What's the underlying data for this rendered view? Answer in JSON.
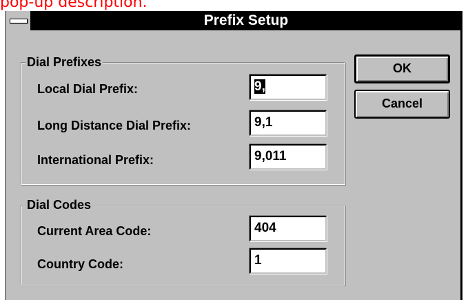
{
  "caption": "pop-up description.",
  "window": {
    "title": "Prefix Setup"
  },
  "dial_prefixes": {
    "legend": "Dial Prefixes",
    "local": {
      "label": "Local Dial Prefix:",
      "selected": "9,",
      "value": ""
    },
    "long_distance": {
      "label": "Long Distance Dial Prefix:",
      "value": "9,1"
    },
    "international": {
      "label": "International Prefix:",
      "value": "9,011"
    }
  },
  "dial_codes": {
    "legend": "Dial Codes",
    "area_code": {
      "label": "Current Area Code:",
      "value": "404"
    },
    "country_code": {
      "label": "Country Code:",
      "value": "1"
    }
  },
  "buttons": {
    "ok": "OK",
    "cancel": "Cancel"
  },
  "colors": {
    "dialog_face": "#c0c0c0",
    "titlebar": "#000000",
    "caption": "#ff0000"
  }
}
